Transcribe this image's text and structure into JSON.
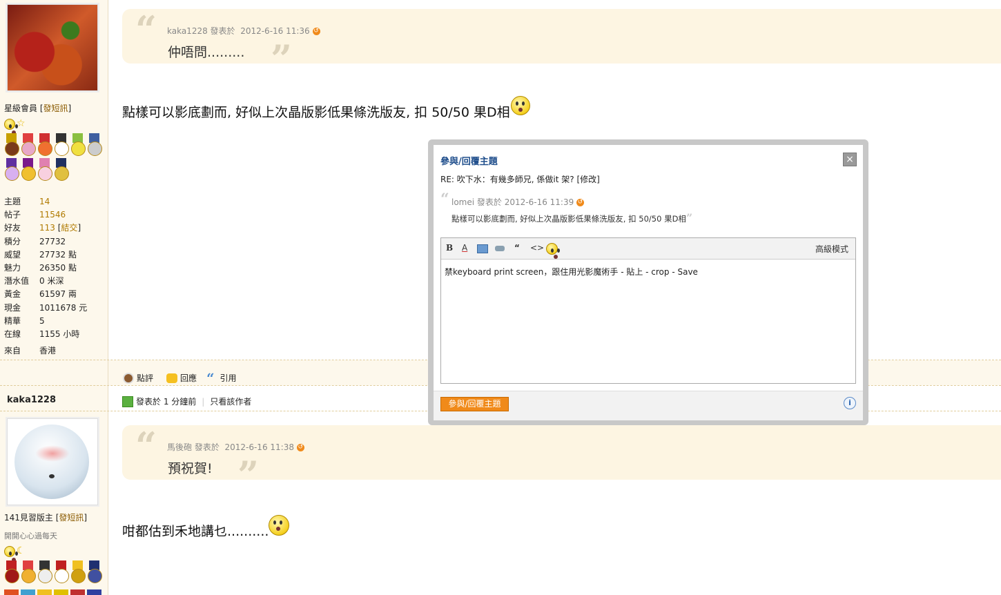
{
  "user1": {
    "rank": "星級會員",
    "pm_link": "發短訊",
    "stats": [
      {
        "key": "主題",
        "value": "14",
        "link": true
      },
      {
        "key": "帖子",
        "value": "11546",
        "link": true
      },
      {
        "key": "好友",
        "value": "113",
        "link": true,
        "extra": "結交"
      },
      {
        "key": "積分",
        "value": "27732"
      },
      {
        "key": "威望",
        "value": "27732 點"
      },
      {
        "key": "魅力",
        "value": "26350 點"
      },
      {
        "key": "潛水值",
        "value": "0 米深"
      },
      {
        "key": "黃金",
        "value": "61597 兩"
      },
      {
        "key": "現金",
        "value": "1011678 元"
      },
      {
        "key": "精華",
        "value": "5"
      },
      {
        "key": "在線",
        "value": "1155 小時"
      }
    ],
    "from_key": "來自",
    "from_value": "香港"
  },
  "post1": {
    "quote_author": "kaka1228 發表於",
    "quote_time": "2012-6-16 11:36",
    "quote_text": "仲唔問.........",
    "body": "點樣可以影底劃而, 好似上次晶版影低果條洗版友, 扣 50/50 果D相"
  },
  "actions": {
    "rate": "點評",
    "reply": "回應",
    "quote": "引用"
  },
  "user2": {
    "name": "kaka1228",
    "rank": "141見習版主",
    "pm_link": "發短訊",
    "signature": "開開心心過每天",
    "posted": "發表於 1 分鐘前",
    "only_author": "只看該作者"
  },
  "post2": {
    "quote_author": "馬後砲 發表於",
    "quote_time": "2012-6-16 11:38",
    "quote_text": "預祝賀!",
    "body": "咁都估到禾地講乜.........."
  },
  "modal": {
    "title": "參與/回覆主題",
    "close": "×",
    "subject": "RE: 吹下水：有幾多師兄, 係做it 架? [修改]",
    "quote_author": "lomei 發表於",
    "quote_time": "2012-6-16 11:39",
    "quote_text": "點樣可以影底劃而, 好似上次晶版影低果條洗版友, 扣 50/50 果D相",
    "advanced_mode": "高級模式",
    "editor_text": "禁keyboard print screen，跟住用光影魔術手 - 貼上 - crop - Save",
    "submit": "參與/回覆主題",
    "toolbar_bold": "B",
    "toolbar_color": "A",
    "toolbar_quote": "“",
    "toolbar_code": "<>",
    "info": "i"
  }
}
